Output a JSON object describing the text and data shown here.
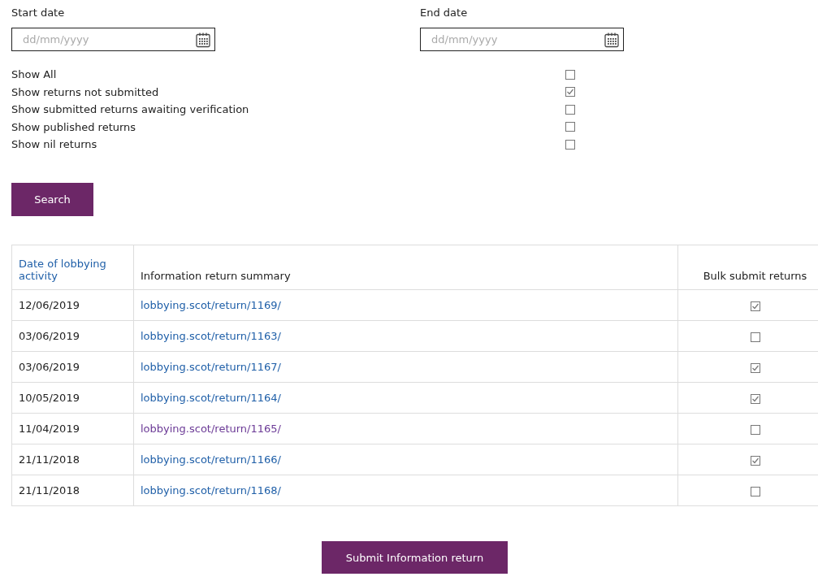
{
  "date_fields": [
    {
      "label": "Start date",
      "placeholder": "dd/mm/yyyy"
    },
    {
      "label": "End date",
      "placeholder": "dd/mm/yyyy"
    }
  ],
  "filters": [
    {
      "label": "Show All",
      "checked": false
    },
    {
      "label": "Show returns not submitted",
      "checked": true
    },
    {
      "label": "Show submitted returns awaiting verification",
      "checked": false
    },
    {
      "label": "Show published returns",
      "checked": false
    },
    {
      "label": "Show nil returns",
      "checked": false
    }
  ],
  "search_button": "Search",
  "table": {
    "columns": [
      {
        "label": "Date of lobbying activity",
        "kind": "link"
      },
      {
        "label": "Information return summary",
        "kind": "text"
      },
      {
        "label": "Bulk submit returns",
        "kind": "text"
      }
    ],
    "rows": [
      {
        "date": "12/06/2019",
        "summary": "lobbying.scot/return/1169/",
        "visited": false,
        "checked": true
      },
      {
        "date": "03/06/2019",
        "summary": "lobbying.scot/return/1163/",
        "visited": false,
        "checked": false
      },
      {
        "date": "03/06/2019",
        "summary": "lobbying.scot/return/1167/",
        "visited": false,
        "checked": true
      },
      {
        "date": "10/05/2019",
        "summary": "lobbying.scot/return/1164/",
        "visited": false,
        "checked": true
      },
      {
        "date": "11/04/2019",
        "summary": "lobbying.scot/return/1165/",
        "visited": true,
        "checked": false
      },
      {
        "date": "21/11/2018",
        "summary": "lobbying.scot/return/1166/",
        "visited": false,
        "checked": true
      },
      {
        "date": "21/11/2018",
        "summary": "lobbying.scot/return/1168/",
        "visited": false,
        "checked": false
      }
    ]
  },
  "submit_button": "Submit Information return"
}
